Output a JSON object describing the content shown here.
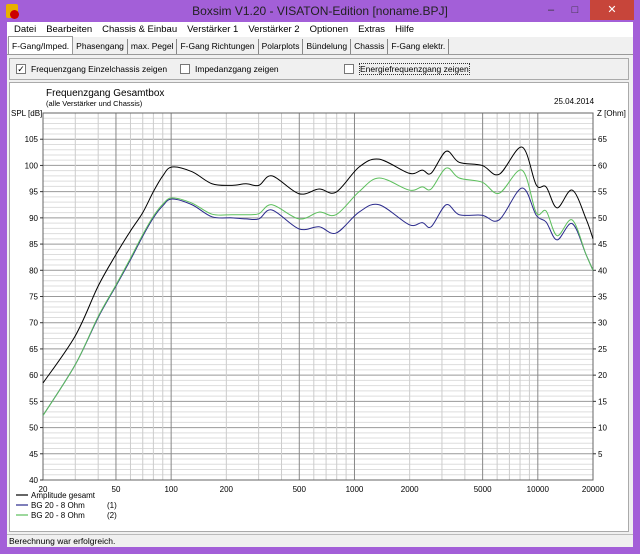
{
  "window": {
    "title": "Boxsim V1.20 - VISATON-Edition [noname.BPJ]",
    "minimize": "–",
    "maximize": "□",
    "close": "✕"
  },
  "menu": [
    "Datei",
    "Bearbeiten",
    "Chassis & Einbau",
    "Verstärker 1",
    "Verstärker 2",
    "Optionen",
    "Extras",
    "Hilfe"
  ],
  "tabs": [
    {
      "label": "F-Gang/Imped.",
      "active": true
    },
    {
      "label": "Phasengang"
    },
    {
      "label": "max. Pegel"
    },
    {
      "label": "F-Gang Richtungen"
    },
    {
      "label": "Polarplots"
    },
    {
      "label": "Bündelung"
    },
    {
      "label": "Chassis"
    },
    {
      "label": "F-Gang elektr."
    }
  ],
  "options": [
    {
      "label": "Frequenzgang Einzelchassis zeigen",
      "checked": true
    },
    {
      "label": "Impedanzgang zeigen",
      "checked": false
    },
    {
      "label": "Energiefrequenzgang zeigen",
      "checked": false
    }
  ],
  "status": "Berechnung war erfolgreich.",
  "chart_data": {
    "type": "line",
    "title": "Frequenzgang Gesamtbox",
    "subtitle": "(alle Verstärker und Chassis)",
    "date": "25.04.2014",
    "ylabel": "SPL [dB]",
    "y2label": "Z [Ohm]",
    "xscale": "log",
    "xlim": [
      20,
      20000
    ],
    "ylim": [
      40,
      110
    ],
    "y2lim": [
      0,
      70
    ],
    "grid": true,
    "legend": "bottom-left",
    "xticks": [
      20,
      50,
      100,
      200,
      500,
      1000,
      2000,
      5000,
      10000,
      20000
    ],
    "yticks": [
      40,
      45,
      50,
      55,
      60,
      65,
      70,
      75,
      80,
      85,
      90,
      95,
      100,
      105
    ],
    "y2ticks": [
      5,
      10,
      15,
      20,
      25,
      30,
      35,
      40,
      45,
      50,
      55,
      60,
      65
    ],
    "series": [
      {
        "name": "Amplitude gesamt",
        "legend_suffix": "",
        "color": "#000000",
        "x": [
          20,
          30,
          40,
          50,
          60,
          70,
          80,
          90,
          101,
          130,
          167,
          215,
          256,
          301,
          355,
          498,
          641,
          793,
          1060,
          1362,
          1986,
          2340,
          2619,
          3163,
          3724,
          4970,
          6150,
          8200,
          9800,
          11100,
          12740,
          15400,
          18330,
          20000
        ],
        "y": [
          58.5,
          67.5,
          77,
          83,
          87.5,
          91,
          95,
          98,
          99.7,
          98.8,
          96.5,
          96.2,
          96.5,
          96.2,
          98,
          94.6,
          95.5,
          94.9,
          99.7,
          101.2,
          98.5,
          99.1,
          98.5,
          102.7,
          100.6,
          100,
          98.3,
          103.5,
          96.3,
          95.9,
          91.9,
          95.3,
          89.8,
          86
        ]
      },
      {
        "name": "BG 20 - 8 Ohm",
        "legend_suffix": "(1)",
        "color": "#2a2a8c",
        "x": [
          20,
          30,
          40,
          50,
          60,
          70,
          80,
          90,
          101,
          130,
          167,
          215,
          256,
          301,
          355,
          498,
          641,
          793,
          1060,
          1362,
          1986,
          2340,
          2619,
          3163,
          3724,
          4970,
          6150,
          8200,
          9800,
          11100,
          12740,
          15400,
          18330,
          20000
        ],
        "y": [
          52.3,
          62,
          71,
          77,
          82,
          86.5,
          90,
          92.3,
          93.6,
          92.5,
          90.2,
          90,
          89.8,
          89.8,
          91.5,
          87.9,
          88.3,
          87.1,
          91.1,
          92.5,
          88.7,
          89.1,
          88.3,
          92.5,
          90.6,
          90.5,
          89.6,
          95.7,
          90.5,
          89.2,
          85.8,
          88.9,
          83,
          80
        ]
      },
      {
        "name": "BG 20 - 8 Ohm",
        "legend_suffix": "(2)",
        "color": "#5cbf5c",
        "x": [
          20,
          30,
          40,
          50,
          60,
          70,
          80,
          90,
          101,
          130,
          167,
          215,
          256,
          301,
          355,
          498,
          641,
          793,
          1060,
          1362,
          1986,
          2340,
          2619,
          3163,
          3724,
          4970,
          6150,
          8200,
          9800,
          11100,
          12740,
          15400,
          18330,
          20000
        ],
        "y": [
          52.3,
          62,
          71.2,
          77.2,
          82.3,
          86.8,
          90.3,
          92.6,
          93.8,
          92.8,
          90.7,
          90.6,
          90.6,
          90.8,
          92.5,
          89.8,
          91.1,
          90.6,
          95,
          97.6,
          95.3,
          95.9,
          95.5,
          99.5,
          97.6,
          96.8,
          94.7,
          99.1,
          91,
          91.3,
          86.6,
          89.6,
          83,
          80
        ]
      }
    ]
  }
}
